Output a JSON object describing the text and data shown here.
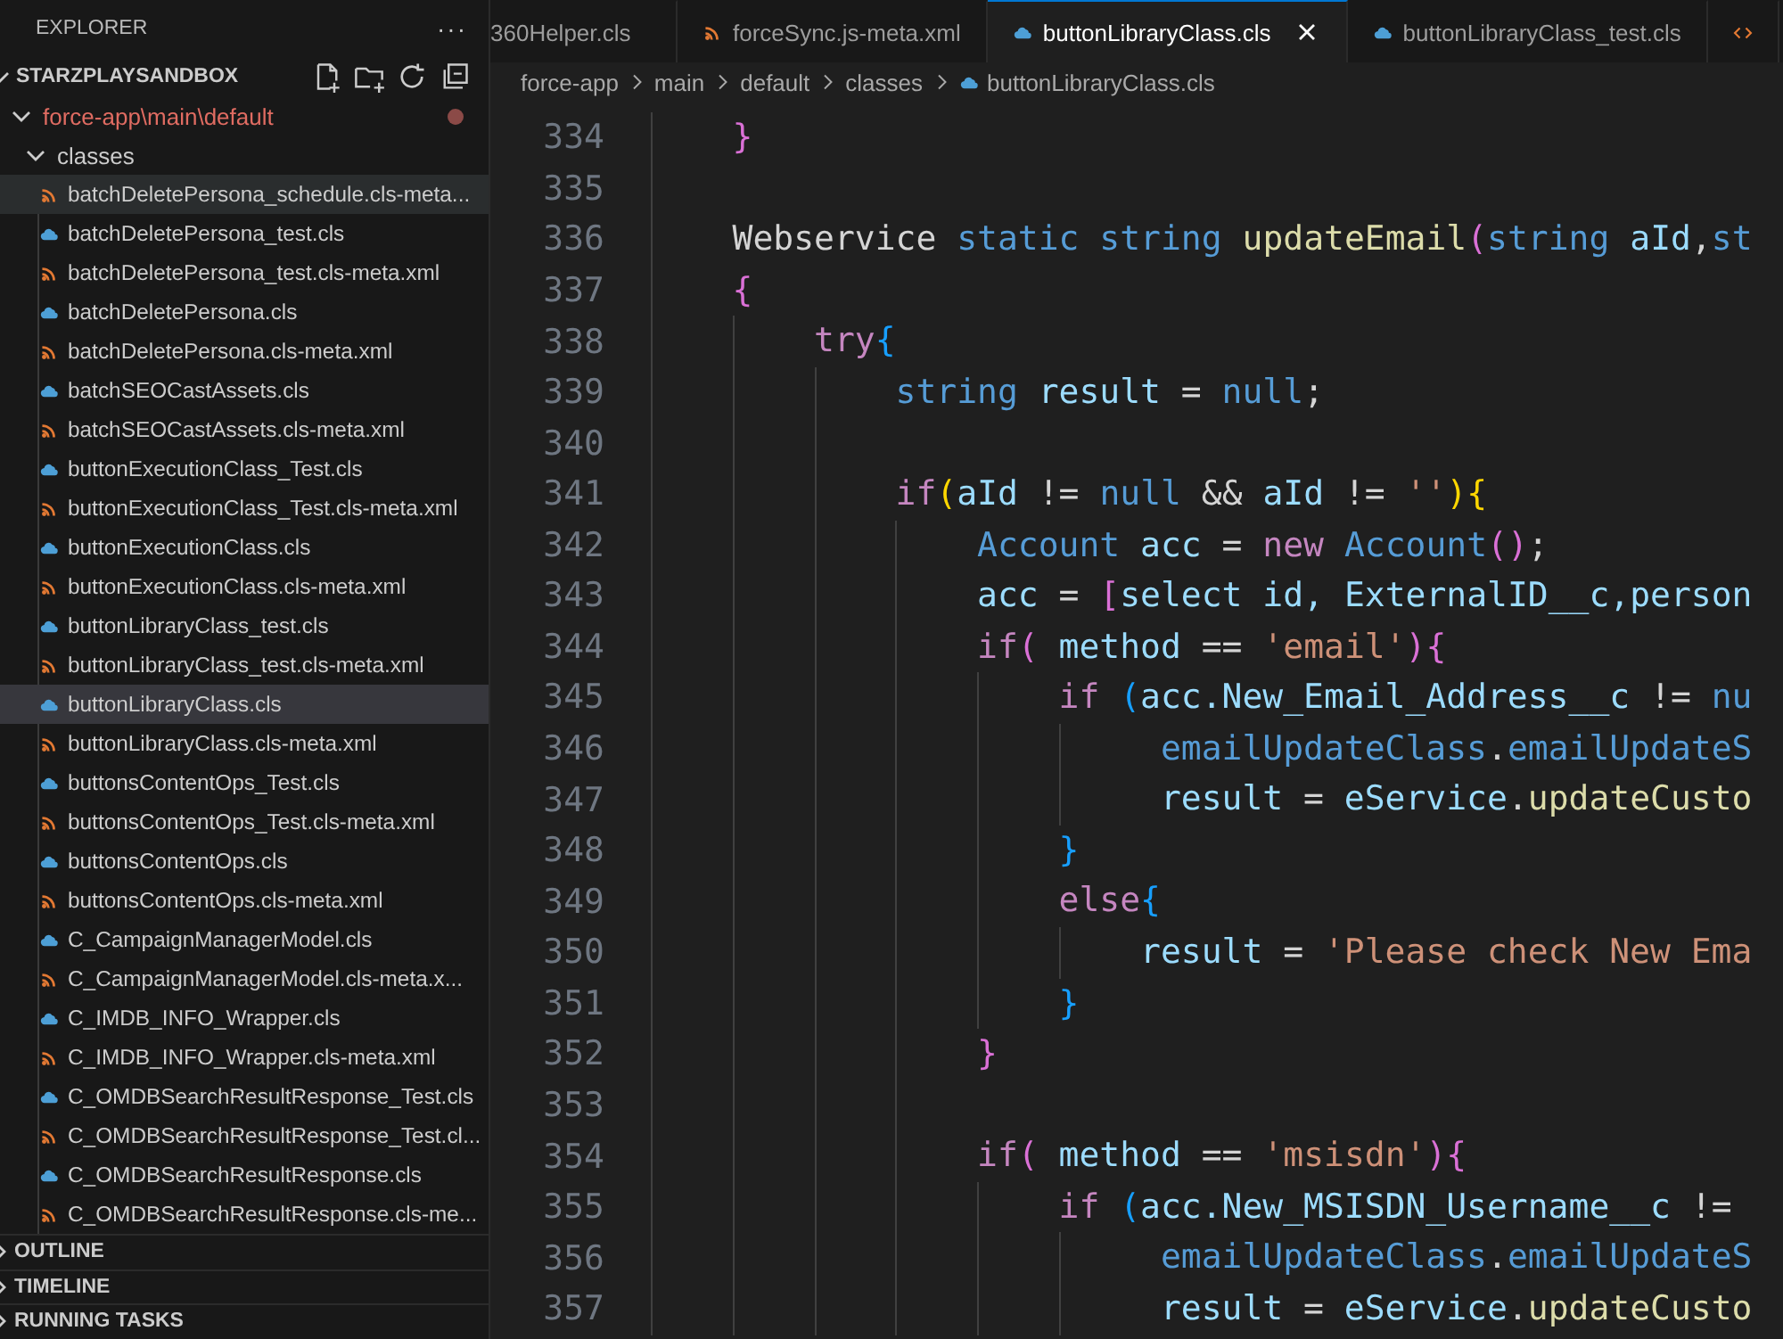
{
  "sidebar": {
    "title": "EXPLORER",
    "more": "···",
    "workspace": {
      "name": "STARZPLAYSANDBOX",
      "expanded": true
    },
    "folder": {
      "path": "force-app\\main\\default",
      "expanded": true,
      "modified": true
    },
    "subfolder": {
      "name": "classes",
      "expanded": true
    },
    "files": [
      {
        "name": "batchDeletePersona_schedule.cls-meta...",
        "kind": "xml",
        "selected": false,
        "hovered": true
      },
      {
        "name": "batchDeletePersona_test.cls",
        "kind": "apex",
        "selected": false,
        "hovered": false
      },
      {
        "name": "batchDeletePersona_test.cls-meta.xml",
        "kind": "xml",
        "selected": false,
        "hovered": false
      },
      {
        "name": "batchDeletePersona.cls",
        "kind": "apex",
        "selected": false,
        "hovered": false
      },
      {
        "name": "batchDeletePersona.cls-meta.xml",
        "kind": "xml",
        "selected": false,
        "hovered": false
      },
      {
        "name": "batchSEOCastAssets.cls",
        "kind": "apex",
        "selected": false,
        "hovered": false
      },
      {
        "name": "batchSEOCastAssets.cls-meta.xml",
        "kind": "xml",
        "selected": false,
        "hovered": false
      },
      {
        "name": "buttonExecutionClass_Test.cls",
        "kind": "apex",
        "selected": false,
        "hovered": false
      },
      {
        "name": "buttonExecutionClass_Test.cls-meta.xml",
        "kind": "xml",
        "selected": false,
        "hovered": false
      },
      {
        "name": "buttonExecutionClass.cls",
        "kind": "apex",
        "selected": false,
        "hovered": false
      },
      {
        "name": "buttonExecutionClass.cls-meta.xml",
        "kind": "xml",
        "selected": false,
        "hovered": false
      },
      {
        "name": "buttonLibraryClass_test.cls",
        "kind": "apex",
        "selected": false,
        "hovered": false
      },
      {
        "name": "buttonLibraryClass_test.cls-meta.xml",
        "kind": "xml",
        "selected": false,
        "hovered": false
      },
      {
        "name": "buttonLibraryClass.cls",
        "kind": "apex",
        "selected": true,
        "hovered": false
      },
      {
        "name": "buttonLibraryClass.cls-meta.xml",
        "kind": "xml",
        "selected": false,
        "hovered": false
      },
      {
        "name": "buttonsContentOps_Test.cls",
        "kind": "apex",
        "selected": false,
        "hovered": false
      },
      {
        "name": "buttonsContentOps_Test.cls-meta.xml",
        "kind": "xml",
        "selected": false,
        "hovered": false
      },
      {
        "name": "buttonsContentOps.cls",
        "kind": "apex",
        "selected": false,
        "hovered": false
      },
      {
        "name": "buttonsContentOps.cls-meta.xml",
        "kind": "xml",
        "selected": false,
        "hovered": false
      },
      {
        "name": "C_CampaignManagerModel.cls",
        "kind": "apex",
        "selected": false,
        "hovered": false
      },
      {
        "name": "C_CampaignManagerModel.cls-meta.x...",
        "kind": "xml",
        "selected": false,
        "hovered": false
      },
      {
        "name": "C_IMDB_INFO_Wrapper.cls",
        "kind": "apex",
        "selected": false,
        "hovered": false
      },
      {
        "name": "C_IMDB_INFO_Wrapper.cls-meta.xml",
        "kind": "xml",
        "selected": false,
        "hovered": false
      },
      {
        "name": "C_OMDBSearchResultResponse_Test.cls",
        "kind": "apex",
        "selected": false,
        "hovered": false
      },
      {
        "name": "C_OMDBSearchResultResponse_Test.cl...",
        "kind": "xml",
        "selected": false,
        "hovered": false
      },
      {
        "name": "C_OMDBSearchResultResponse.cls",
        "kind": "apex",
        "selected": false,
        "hovered": false
      },
      {
        "name": "C_OMDBSearchResultResponse.cls-me...",
        "kind": "xml",
        "selected": false,
        "hovered": false
      }
    ],
    "panels": [
      {
        "title": "OUTLINE",
        "expanded": false
      },
      {
        "title": "TIMELINE",
        "expanded": false
      },
      {
        "title": "RUNNING TASKS",
        "expanded": false
      }
    ]
  },
  "tabs": [
    {
      "label": "360Helper.cls",
      "kind": "none",
      "selected": false
    },
    {
      "label": "forceSync.js-meta.xml",
      "kind": "xml",
      "selected": false
    },
    {
      "label": "buttonLibraryClass.cls",
      "kind": "apex",
      "selected": true
    },
    {
      "label": "buttonLibraryClass_test.cls",
      "kind": "apex",
      "selected": false
    },
    {
      "kind": "code",
      "selected": false
    }
  ],
  "breadcrumb": [
    "force-app",
    "main",
    "default",
    "classes",
    "buttonLibraryClass.cls"
  ],
  "code": [
    {
      "number": "334",
      "tokens": [
        {
          "text": "    }",
          "kind": "b2"
        }
      ]
    },
    {
      "number": "335"
    },
    {
      "number": "336",
      "tokens": [
        {
          "text": "    Webservice ",
          "kind": "plain"
        },
        {
          "text": "static string ",
          "kind": "type"
        },
        {
          "text": "updateEmail",
          "kind": "func"
        },
        {
          "text": "(",
          "kind": "b2"
        },
        {
          "text": "string ",
          "kind": "type"
        },
        {
          "text": "aId",
          "kind": "var"
        },
        {
          "text": ",",
          "kind": "plain"
        },
        {
          "text": "st",
          "kind": "type"
        }
      ]
    },
    {
      "number": "337",
      "tokens": [
        {
          "text": "    {",
          "kind": "b2"
        }
      ]
    },
    {
      "number": "338",
      "tokens": [
        {
          "text": "        try",
          "kind": "keyword"
        },
        {
          "text": "{",
          "kind": "b3"
        }
      ]
    },
    {
      "number": "339",
      "tokens": [
        {
          "text": "            string ",
          "kind": "type"
        },
        {
          "text": "result",
          "kind": "var"
        },
        {
          "text": " = ",
          "kind": "plain"
        },
        {
          "text": "null",
          "kind": "type"
        },
        {
          "text": ";",
          "kind": "plain"
        }
      ]
    },
    {
      "number": "340"
    },
    {
      "number": "341",
      "tokens": [
        {
          "text": "            if",
          "kind": "keyword"
        },
        {
          "text": "(",
          "kind": "b1"
        },
        {
          "text": "aId",
          "kind": "var"
        },
        {
          "text": " != ",
          "kind": "plain"
        },
        {
          "text": "null",
          "kind": "type"
        },
        {
          "text": " && ",
          "kind": "plain"
        },
        {
          "text": "aId",
          "kind": "var"
        },
        {
          "text": " != ",
          "kind": "plain"
        },
        {
          "text": "''",
          "kind": "string"
        },
        {
          "text": "){",
          "kind": "b1"
        }
      ]
    },
    {
      "number": "342",
      "tokens": [
        {
          "text": "                Account ",
          "kind": "type"
        },
        {
          "text": "acc",
          "kind": "var"
        },
        {
          "text": " = ",
          "kind": "plain"
        },
        {
          "text": "new ",
          "kind": "keyword"
        },
        {
          "text": "Account",
          "kind": "type"
        },
        {
          "text": "()",
          "kind": "b2"
        },
        {
          "text": ";",
          "kind": "plain"
        }
      ]
    },
    {
      "number": "343",
      "tokens": [
        {
          "text": "                acc",
          "kind": "var"
        },
        {
          "text": " = ",
          "kind": "plain"
        },
        {
          "text": "[",
          "kind": "b2"
        },
        {
          "text": "select id, ExternalID__c,person",
          "kind": "var"
        }
      ]
    },
    {
      "number": "344",
      "tokens": [
        {
          "text": "                if",
          "kind": "keyword"
        },
        {
          "text": "(",
          "kind": "b2"
        },
        {
          "text": " method",
          "kind": "var"
        },
        {
          "text": " == ",
          "kind": "plain"
        },
        {
          "text": "'email'",
          "kind": "string"
        },
        {
          "text": "){",
          "kind": "b2"
        }
      ]
    },
    {
      "number": "345",
      "tokens": [
        {
          "text": "                    if ",
          "kind": "keyword"
        },
        {
          "text": "(",
          "kind": "b3"
        },
        {
          "text": "acc.New_Email_Address__c",
          "kind": "var"
        },
        {
          "text": " != ",
          "kind": "plain"
        },
        {
          "text": "nu",
          "kind": "type"
        }
      ]
    },
    {
      "number": "346",
      "tokens": [
        {
          "text": "                         emailUpdateClass",
          "kind": "type"
        },
        {
          "text": ".",
          "kind": "plain"
        },
        {
          "text": "emailUpdateS",
          "kind": "type"
        }
      ]
    },
    {
      "number": "347",
      "tokens": [
        {
          "text": "                         result",
          "kind": "var"
        },
        {
          "text": " = ",
          "kind": "plain"
        },
        {
          "text": "eService",
          "kind": "var"
        },
        {
          "text": ".",
          "kind": "plain"
        },
        {
          "text": "updateCusto",
          "kind": "func"
        }
      ]
    },
    {
      "number": "348",
      "tokens": [
        {
          "text": "                    }",
          "kind": "b3"
        }
      ]
    },
    {
      "number": "349",
      "tokens": [
        {
          "text": "                    else",
          "kind": "keyword"
        },
        {
          "text": "{",
          "kind": "b3"
        }
      ]
    },
    {
      "number": "350",
      "tokens": [
        {
          "text": "                        result",
          "kind": "var"
        },
        {
          "text": " = ",
          "kind": "plain"
        },
        {
          "text": "'Please check New Ema",
          "kind": "string"
        }
      ]
    },
    {
      "number": "351",
      "tokens": [
        {
          "text": "                    }",
          "kind": "b3"
        }
      ]
    },
    {
      "number": "352",
      "tokens": [
        {
          "text": "                }",
          "kind": "b2"
        }
      ]
    },
    {
      "number": "353"
    },
    {
      "number": "354",
      "tokens": [
        {
          "text": "                if",
          "kind": "keyword"
        },
        {
          "text": "(",
          "kind": "b2"
        },
        {
          "text": " method",
          "kind": "var"
        },
        {
          "text": " == ",
          "kind": "plain"
        },
        {
          "text": "'msisdn'",
          "kind": "string"
        },
        {
          "text": "){",
          "kind": "b2"
        }
      ]
    },
    {
      "number": "355",
      "tokens": [
        {
          "text": "                    if ",
          "kind": "keyword"
        },
        {
          "text": "(",
          "kind": "b3"
        },
        {
          "text": "acc.New_MSISDN_Username__c",
          "kind": "var"
        },
        {
          "text": " != ",
          "kind": "plain"
        }
      ]
    },
    {
      "number": "356",
      "tokens": [
        {
          "text": "                         emailUpdateClass",
          "kind": "type"
        },
        {
          "text": ".",
          "kind": "plain"
        },
        {
          "text": "emailUpdateS",
          "kind": "type"
        }
      ]
    },
    {
      "number": "357",
      "tokens": [
        {
          "text": "                         result",
          "kind": "var"
        },
        {
          "text": " = ",
          "kind": "plain"
        },
        {
          "text": "eService",
          "kind": "var"
        },
        {
          "text": ".",
          "kind": "plain"
        },
        {
          "text": "updateCusto",
          "kind": "func"
        }
      ]
    }
  ]
}
